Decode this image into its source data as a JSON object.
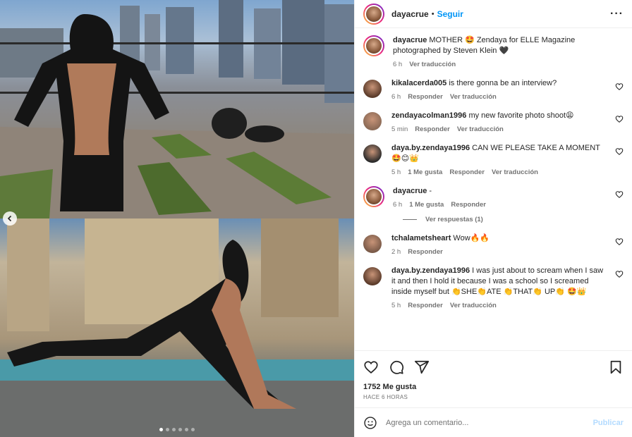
{
  "header": {
    "username": "dayacrue",
    "separator": "•",
    "follow_label": "Seguir",
    "more_label": "···"
  },
  "media": {
    "carousel_dots": 6,
    "active_dot": 0,
    "icons": {
      "prev": "chevron-left-icon"
    }
  },
  "comments": [
    {
      "username": "dayacrue",
      "text": "MOTHER 🤩 Zendaya for ELLE Magazine photographed by Steven Klein 🖤",
      "time": "6 h",
      "likes": "",
      "reply": "",
      "translate": "Ver traducción",
      "has_ring": true,
      "heart": false
    },
    {
      "username": "kikalacerda005",
      "text": "is there gonna be an interview?",
      "time": "6 h",
      "likes": "",
      "reply": "Responder",
      "translate": "Ver traducción",
      "has_ring": false,
      "heart": true
    },
    {
      "username": "zendayacolman1996",
      "text": "my new favorite photo shoot😩",
      "time": "5 min",
      "likes": "",
      "reply": "Responder",
      "translate": "Ver traducción",
      "has_ring": false,
      "heart": true
    },
    {
      "username": "daya.by.zendaya1996",
      "text": "CAN WE PLEASE TAKE A MOMENT 🤩😊👑",
      "time": "5 h",
      "likes": "1 Me gusta",
      "reply": "Responder",
      "translate": "Ver traducción",
      "has_ring": false,
      "heart": true
    },
    {
      "username": "dayacrue",
      "text": "-",
      "time": "6 h",
      "likes": "1 Me gusta",
      "reply": "Responder",
      "translate": "",
      "has_ring": true,
      "heart": true
    },
    {
      "username": "tchalametsheart",
      "text": "Wow🔥🔥",
      "time": "2 h",
      "likes": "",
      "reply": "Responder",
      "translate": "",
      "has_ring": false,
      "heart": true
    },
    {
      "username": "daya.by.zendaya1996",
      "text": "I was just about to scream when I saw it and then I hold it because I was a school so I screamed inside myself but 👏SHE👏ATE 👏THAT👏 UP👏 🤩👑",
      "time": "5 h",
      "likes": "",
      "reply": "Responder",
      "translate": "Ver traducción",
      "has_ring": false,
      "heart": true
    }
  ],
  "view_replies": "Ver respuestas (1)",
  "actions": {
    "icons": [
      "heart-icon",
      "comment-icon",
      "share-icon",
      "save-icon"
    ],
    "likes": "1752 Me gusta",
    "ago": "HACE 6 HORAS"
  },
  "add_comment": {
    "placeholder": "Agrega un comentario...",
    "post_label": "Publicar"
  },
  "colors": {
    "accent": "#0095f6",
    "post_disabled": "#b3dbff",
    "muted": "#737373",
    "text": "#262626"
  }
}
